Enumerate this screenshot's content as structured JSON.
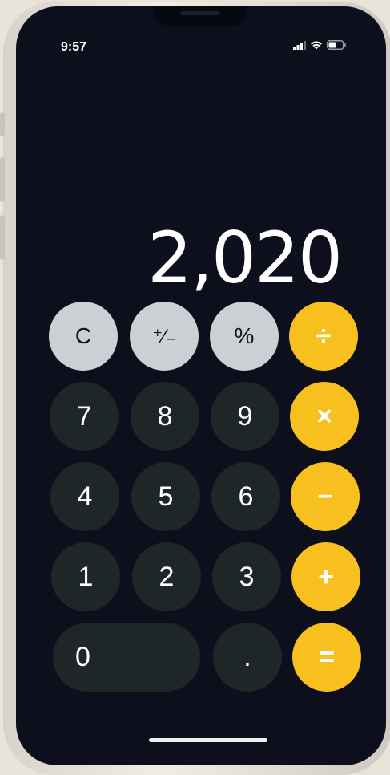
{
  "status_bar": {
    "time": "9:57",
    "icons": [
      "cellular-signal-icon",
      "wifi-icon",
      "battery-icon"
    ]
  },
  "display": {
    "value": "2,020"
  },
  "keys": {
    "clear": "C",
    "sign": "⁺∕₋",
    "percent": "%",
    "divide": "÷",
    "seven": "7",
    "eight": "8",
    "nine": "9",
    "multiply": "×",
    "four": "4",
    "five": "5",
    "six": "6",
    "subtract": "−",
    "one": "1",
    "two": "2",
    "three": "3",
    "add": "+",
    "zero": "0",
    "decimal": ".",
    "equals": "="
  },
  "colors": {
    "screen_background": "#0e0f1c",
    "function_key": "#cbd0d5",
    "number_key": "#1e2628",
    "operator_key": "#f8c01f",
    "text": "#ffffff"
  }
}
